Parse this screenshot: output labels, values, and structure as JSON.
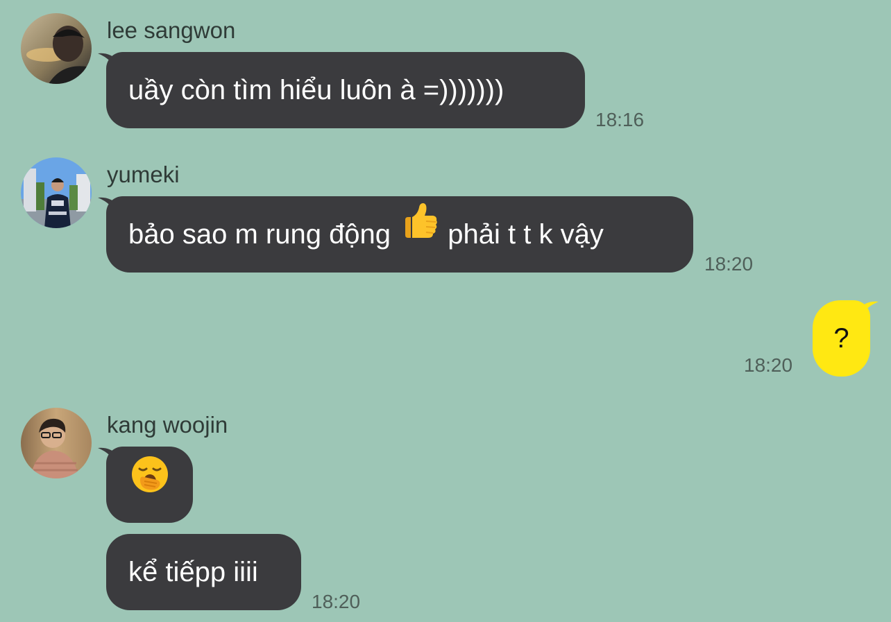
{
  "theme": {
    "background": "#9dc6b6",
    "bubble_other": "#3b3b3e",
    "bubble_mine": "#ffe812",
    "text_other": "#ffffff",
    "text_mine": "#111111"
  },
  "messages": [
    {
      "sender": "lee sangwon",
      "avatar": "profile-photo",
      "text": "uầy còn tìm hiểu luôn à =)))))))",
      "time": "18:16"
    },
    {
      "sender": "yumeki",
      "avatar": "profile-photo",
      "text_before_emoji": "bảo sao m rung động",
      "emoji": "thumbs-up-emoji",
      "text_after_emoji": "phải t t k vậy",
      "time": "18:20"
    },
    {
      "sender": "me",
      "text": "?",
      "time": "18:20"
    },
    {
      "sender": "kang woojin",
      "avatar": "profile-photo",
      "emoji": "yawning-face-emoji",
      "followup_text": "kể tiếpp iiii",
      "time": "18:20"
    }
  ]
}
